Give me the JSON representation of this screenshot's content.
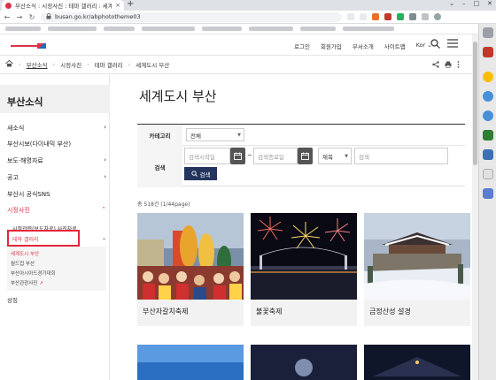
{
  "browser": {
    "tab_title": "부산소식 : 시정사진 : 테마 갤러리 : 세계도",
    "tab_close": "×",
    "new_tab": "+",
    "window_controls": [
      "⌄",
      "–",
      "□",
      "✕"
    ],
    "url": "busan.go.kr/abphototheme03",
    "nav": {
      "back": "←",
      "forward": "→",
      "reload": "↻"
    },
    "lock_icon": "lock-icon"
  },
  "header": {
    "top_links": [
      "로그인",
      "회원가입",
      "부서소개",
      "사이트맵",
      "Kor ⌄"
    ],
    "icons": [
      "search-icon",
      "menu-icon"
    ]
  },
  "breadcrumb": {
    "items": [
      "부산소식",
      "시정사진",
      "테마 갤러리",
      "세계도시 부산"
    ],
    "tools": [
      "share-icon",
      "print-icon",
      "more-icon"
    ]
  },
  "sidebar": {
    "title": "부산소식",
    "items": [
      {
        "label": "새소식",
        "arrow": "›"
      },
      {
        "label": "부산시보(다이내믹 부산)",
        "arrow": ""
      },
      {
        "label": "보도·해명자료",
        "arrow": "›"
      },
      {
        "label": "공고",
        "arrow": "›"
      },
      {
        "label": "부산시 공식SNS",
        "arrow": ""
      },
      {
        "label": "시정사진",
        "arrow": "⌃"
      }
    ],
    "sub_items": [
      {
        "label": "시정관련(보도자료) 사진자료"
      },
      {
        "label": "테마 갤러리",
        "arrow": "⌄"
      }
    ],
    "subsub_items": [
      "세계도시 부산",
      "월드컵 부산",
      "부산아시아드경기대회",
      "부산관광사진"
    ],
    "last_item": "상징"
  },
  "main": {
    "title": "세계도시 부산",
    "filter": {
      "category_label": "카테고리",
      "category_value": "전체",
      "search_label": "검색",
      "start_placeholder": "검색시작일",
      "end_placeholder": "검색종료일",
      "field_value": "제목",
      "keyword_placeholder": "검색",
      "search_button": "검색",
      "tilde": "~"
    },
    "count_text": "총 518건 (1/44page)",
    "cards": [
      {
        "caption": "부산자갈치축제"
      },
      {
        "caption": "불꽃축제"
      },
      {
        "caption": "금정산성 설경"
      }
    ]
  }
}
